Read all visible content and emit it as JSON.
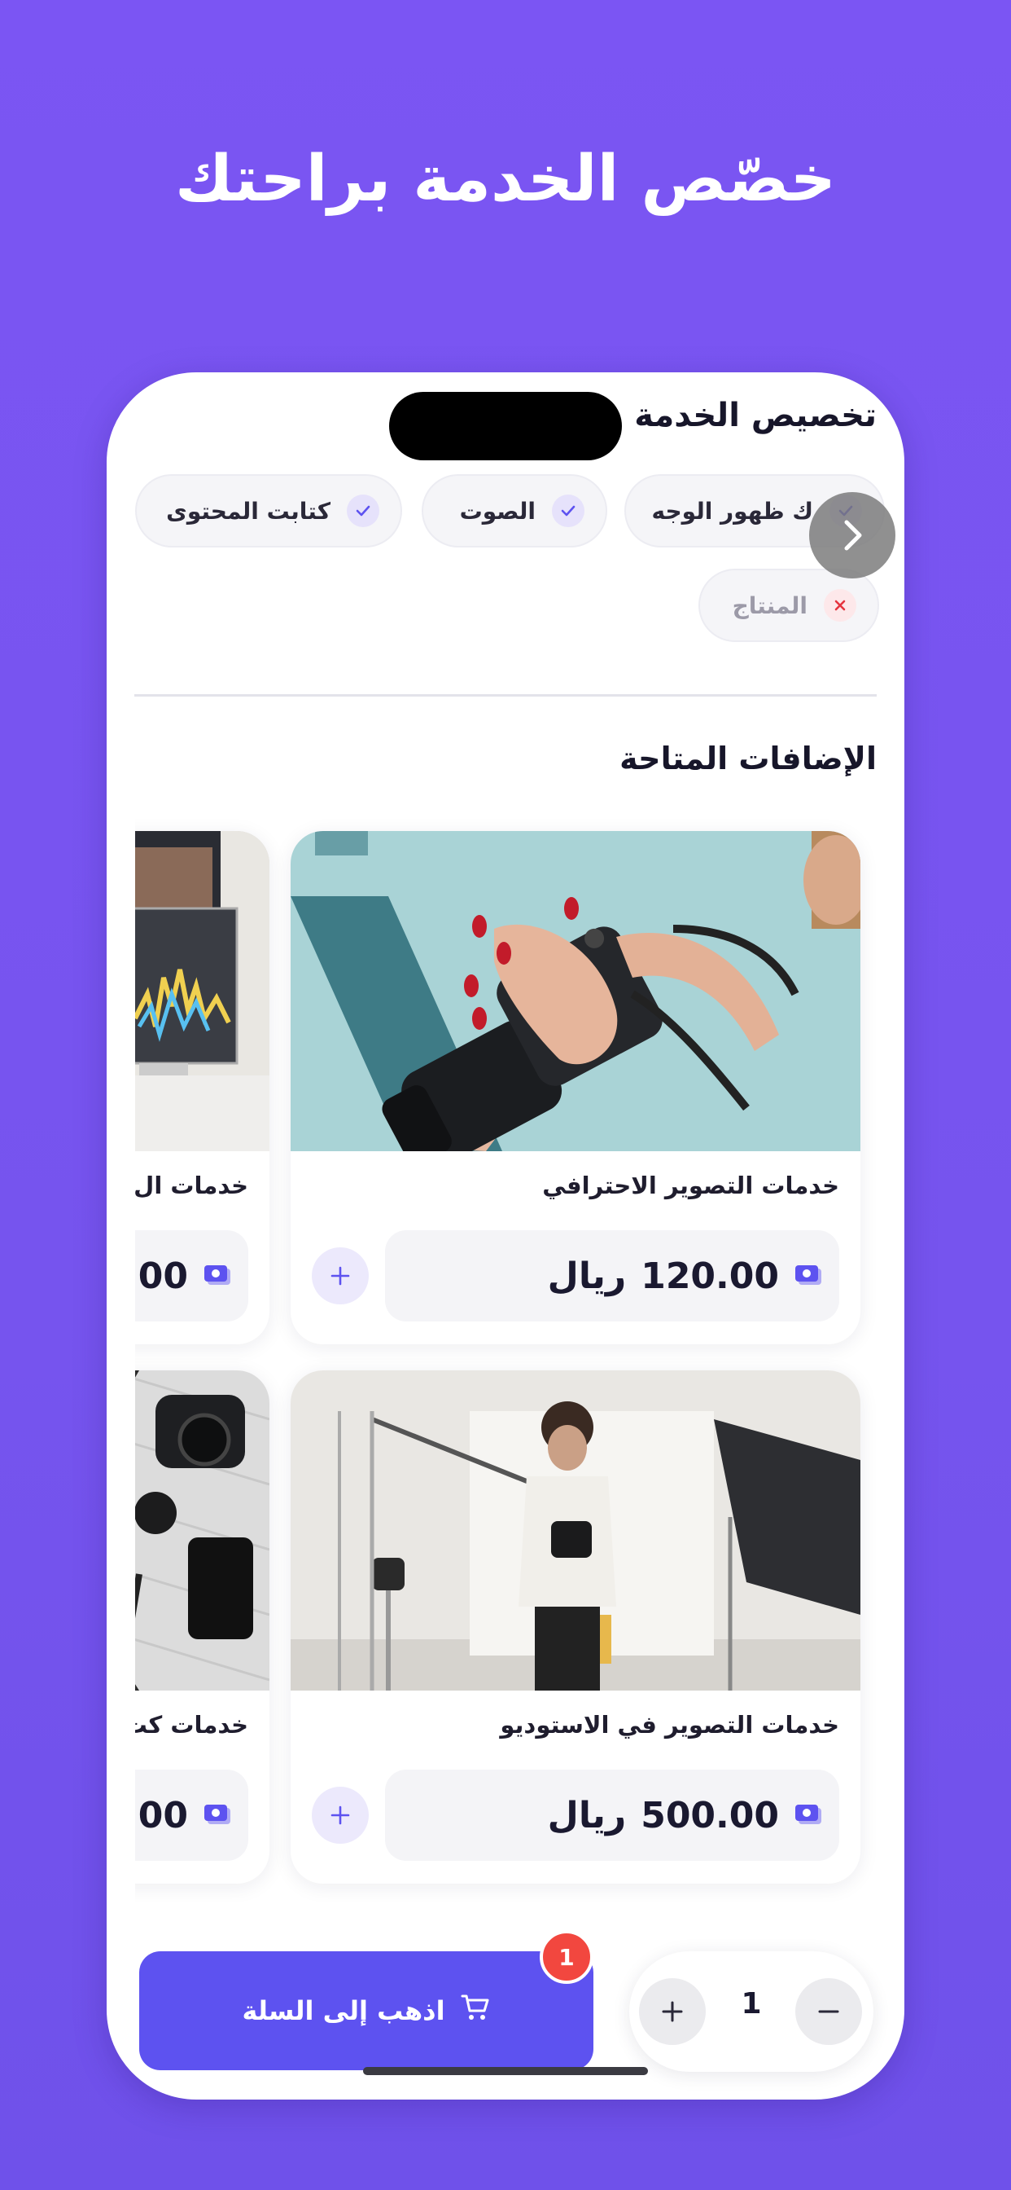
{
  "headline": "خصّص الخدمة براحتك",
  "screen": {
    "title": "تخصيص الخدمة",
    "section_title": "الإضافات المتاحة"
  },
  "chips": [
    {
      "label": "ك ظهور الوجه",
      "selected": true
    },
    {
      "label": "الصوت",
      "selected": true
    },
    {
      "label": "كتابت المحتوى",
      "selected": true
    },
    {
      "label": "المنتاج",
      "selected": false
    }
  ],
  "cards": [
    {
      "name": "خدمات التصوير الاحترافي",
      "price": "120.00",
      "currency": "ريال"
    },
    {
      "name": "خدمات ال",
      "price": "00"
    },
    {
      "name": "خدمات التصوير في الاستوديو",
      "price": "500.00",
      "currency": "ريال"
    },
    {
      "name": "خدمات كت",
      "price": "00"
    }
  ],
  "cart": {
    "label": "اذهب إلى السلة",
    "badge": "1"
  },
  "quantity": {
    "value": "1"
  },
  "colors": {
    "background": "#7b55f3",
    "accent": "#5d52f0",
    "badge": "#f2473f",
    "chip_check": "#5d52f0",
    "chip_remove": "#e5343f"
  }
}
